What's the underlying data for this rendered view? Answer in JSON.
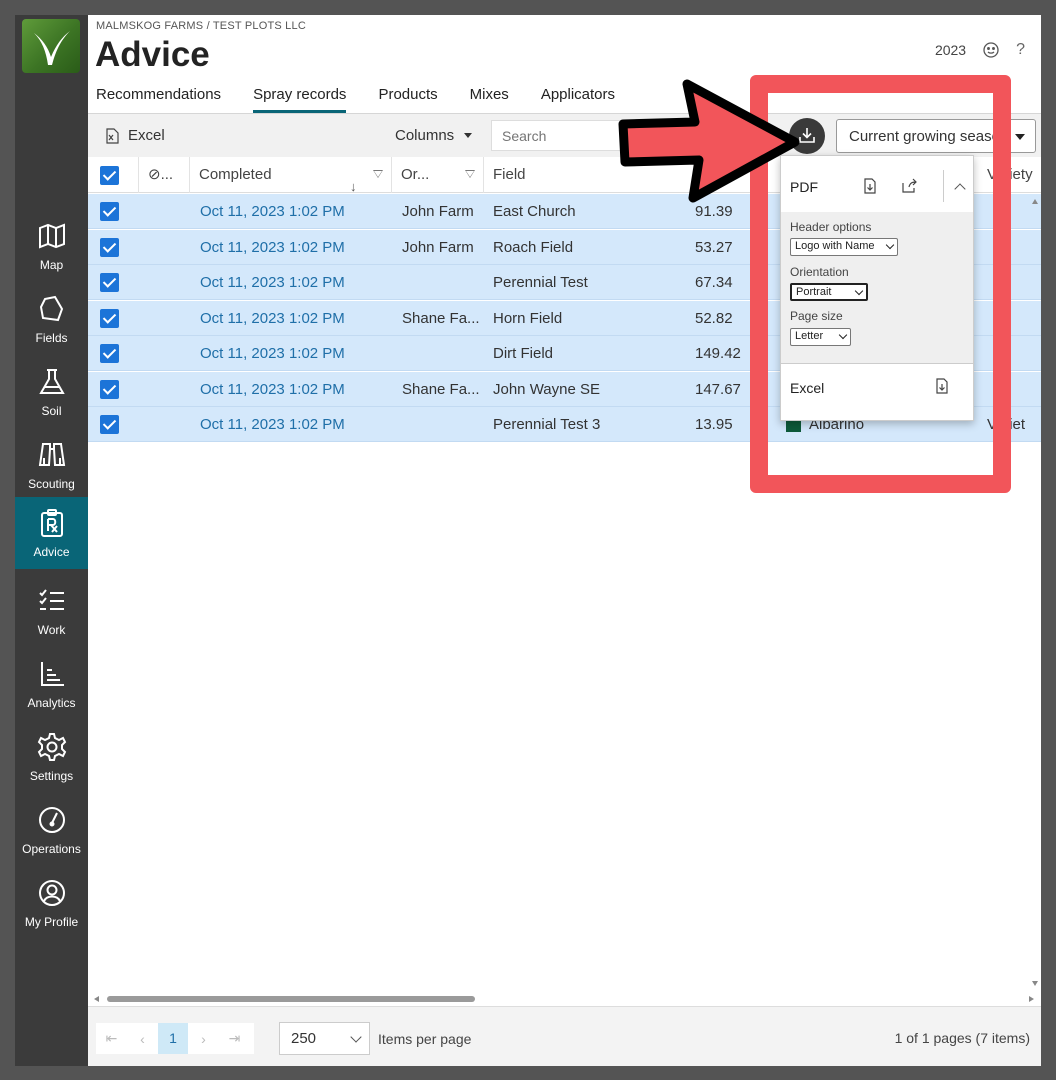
{
  "header": {
    "breadcrumb": "MALMSKOG FARMS / TEST PLOTS LLC",
    "title": "Advice",
    "year": "2023",
    "help": "?"
  },
  "sidebar": {
    "items": [
      {
        "label": "Map",
        "icon": "map-icon"
      },
      {
        "label": "Fields",
        "icon": "fields-icon"
      },
      {
        "label": "Soil",
        "icon": "flask-icon"
      },
      {
        "label": "Scouting",
        "icon": "binoculars-icon"
      },
      {
        "label": "Advice",
        "icon": "prescription-icon",
        "active": true
      },
      {
        "label": "Work",
        "icon": "checklist-icon"
      },
      {
        "label": "Analytics",
        "icon": "bar-chart-icon"
      },
      {
        "label": "Settings",
        "icon": "gear-icon"
      },
      {
        "label": "Operations",
        "icon": "gauge-icon"
      },
      {
        "label": "My Profile",
        "icon": "user-circle-icon"
      }
    ]
  },
  "tabs": [
    {
      "label": "Recommendations"
    },
    {
      "label": "Spray records",
      "active": true
    },
    {
      "label": "Products"
    },
    {
      "label": "Mixes"
    },
    {
      "label": "Applicators"
    }
  ],
  "toolbar": {
    "excel_label": "Excel",
    "columns_label": "Columns",
    "search_placeholder": "Search",
    "season_value": "Current growing season"
  },
  "grid": {
    "headers": {
      "link": "⊘...",
      "completed": "Completed",
      "org": "Or...",
      "field": "Field",
      "variety": "Variety"
    },
    "rows": [
      {
        "completed": "Oct 11, 2023 1:02 PM",
        "org": "John Farm",
        "field": "East Church",
        "area": "91.39"
      },
      {
        "completed": "Oct 11, 2023 1:02 PM",
        "org": "John Farm",
        "field": "Roach Field",
        "area": "53.27"
      },
      {
        "completed": "Oct 11, 2023 1:02 PM",
        "org": "",
        "field": "Perennial Test",
        "area": "67.34"
      },
      {
        "completed": "Oct 11, 2023 1:02 PM",
        "org": "Shane Fa...",
        "field": "Horn Field",
        "area": "52.82"
      },
      {
        "completed": "Oct 11, 2023 1:02 PM",
        "org": "",
        "field": "Dirt Field",
        "area": "149.42"
      },
      {
        "completed": "Oct 11, 2023 1:02 PM",
        "org": "Shane Fa...",
        "field": "John Wayne SE",
        "area": "147.67"
      },
      {
        "completed": "Oct 11, 2023 1:02 PM",
        "org": "",
        "field": "Perennial Test 3",
        "area": "13.95",
        "product": "Albarino",
        "variety": "Variet"
      }
    ]
  },
  "export_menu": {
    "pdf_label": "PDF",
    "header_options_label": "Header options",
    "header_options_value": "Logo with Name",
    "orientation_label": "Orientation",
    "orientation_value": "Portrait",
    "page_size_label": "Page size",
    "page_size_value": "Letter",
    "excel_label": "Excel"
  },
  "pager": {
    "current_page": "1",
    "page_size": "250",
    "items_per_page_label": "Items per page",
    "info": "1 of 1 pages (7 items)"
  },
  "colors": {
    "accent": "#096577",
    "selection": "#d4e8fb",
    "checkbox": "#1c74d8",
    "annotation": "#f2555a"
  }
}
